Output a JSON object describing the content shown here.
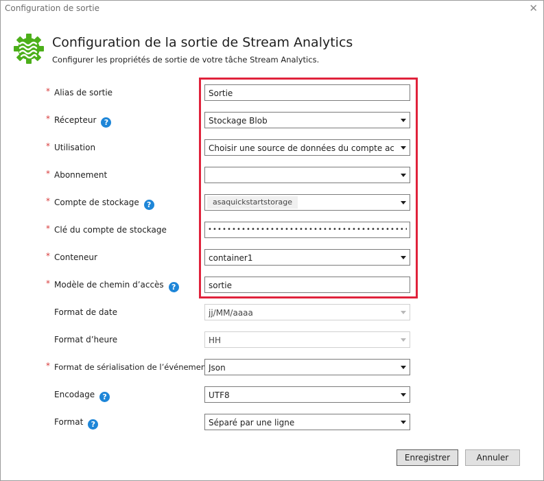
{
  "window": {
    "title": "Configuration de sortie",
    "close_icon": "close-icon"
  },
  "header": {
    "title": "Configuration de la sortie de Stream Analytics",
    "subtitle": "Configurer les propriétés de sortie de votre tâche Stream Analytics.",
    "icon": "stream-analytics-gear-icon",
    "icon_color": "#4caf1a"
  },
  "required_mark": "*",
  "help_glyph": "?",
  "fields": {
    "alias": {
      "label": "Alias de sortie",
      "value": "Sortie"
    },
    "receiver": {
      "label": "Récepteur",
      "value": "Stockage Blob"
    },
    "usage": {
      "label": "Utilisation",
      "value": "Choisir une source de données du compte actuel"
    },
    "subscription": {
      "label": "Abonnement",
      "value": ""
    },
    "storage_account": {
      "label": "Compte de stockage",
      "value": "asaquickstartstorage"
    },
    "storage_key": {
      "label": "Clé du compte de stockage",
      "value": "••••••••••••••••••••••••••••••••••••••••••••••••"
    },
    "container": {
      "label": "Conteneur",
      "value": "container1"
    },
    "path_pattern": {
      "label": "Modèle de chemin d’accès",
      "value": "sortie"
    },
    "date_format": {
      "label": "Format de date",
      "value": "jj/MM/aaaa"
    },
    "time_format": {
      "label": "Format d’heure",
      "value": "HH"
    },
    "serialization": {
      "label": "Format de sérialisation de l’événement",
      "value": "Json"
    },
    "encoding": {
      "label": "Encodage",
      "value": "UTF8"
    },
    "format": {
      "label": "Format",
      "value": "Séparé par une ligne"
    }
  },
  "buttons": {
    "save": "Enregistrer",
    "cancel": "Annuler"
  },
  "colors": {
    "highlight": "#e0223b",
    "required": "#d83b3b",
    "help": "#1e86d8"
  }
}
